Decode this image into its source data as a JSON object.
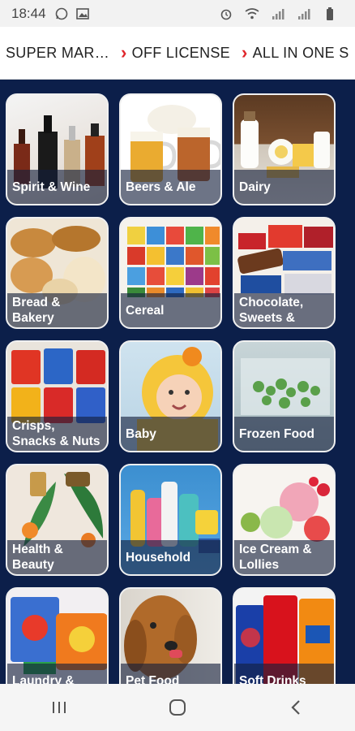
{
  "status": {
    "time": "18:44"
  },
  "nav": {
    "items": [
      "SUPER MAR…",
      "OFF LICENSE",
      "ALL IN ONE S"
    ]
  },
  "categories": [
    {
      "label": "Spirit & Wine",
      "icon": "spirits-bottles-icon"
    },
    {
      "label": "Beers & Ale",
      "icon": "beer-mugs-icon"
    },
    {
      "label": "Dairy",
      "icon": "dairy-products-icon"
    },
    {
      "label": "Bread & Bakery",
      "icon": "bread-icon"
    },
    {
      "label": "Cereal",
      "icon": "cereal-boxes-icon"
    },
    {
      "label": "Chocolate, Sweets &",
      "icon": "chocolate-icon"
    },
    {
      "label": "Crisps, Snacks & Nuts",
      "icon": "crisps-icon"
    },
    {
      "label": "Baby",
      "icon": "baby-icon"
    },
    {
      "label": "Frozen Food",
      "icon": "frozen-food-icon"
    },
    {
      "label": "Health & Beauty",
      "icon": "beauty-products-icon"
    },
    {
      "label": "Household",
      "icon": "cleaning-products-icon"
    },
    {
      "label": "Ice Cream & Lollies",
      "icon": "ice-cream-icon"
    },
    {
      "label": "Laundry &",
      "icon": "laundry-icon"
    },
    {
      "label": "Pet Food",
      "icon": "pet-icon"
    },
    {
      "label": "Soft Drinks",
      "icon": "soft-drinks-icon"
    }
  ],
  "colors": {
    "background": "#0c1f4a",
    "accent": "#e0262b"
  }
}
